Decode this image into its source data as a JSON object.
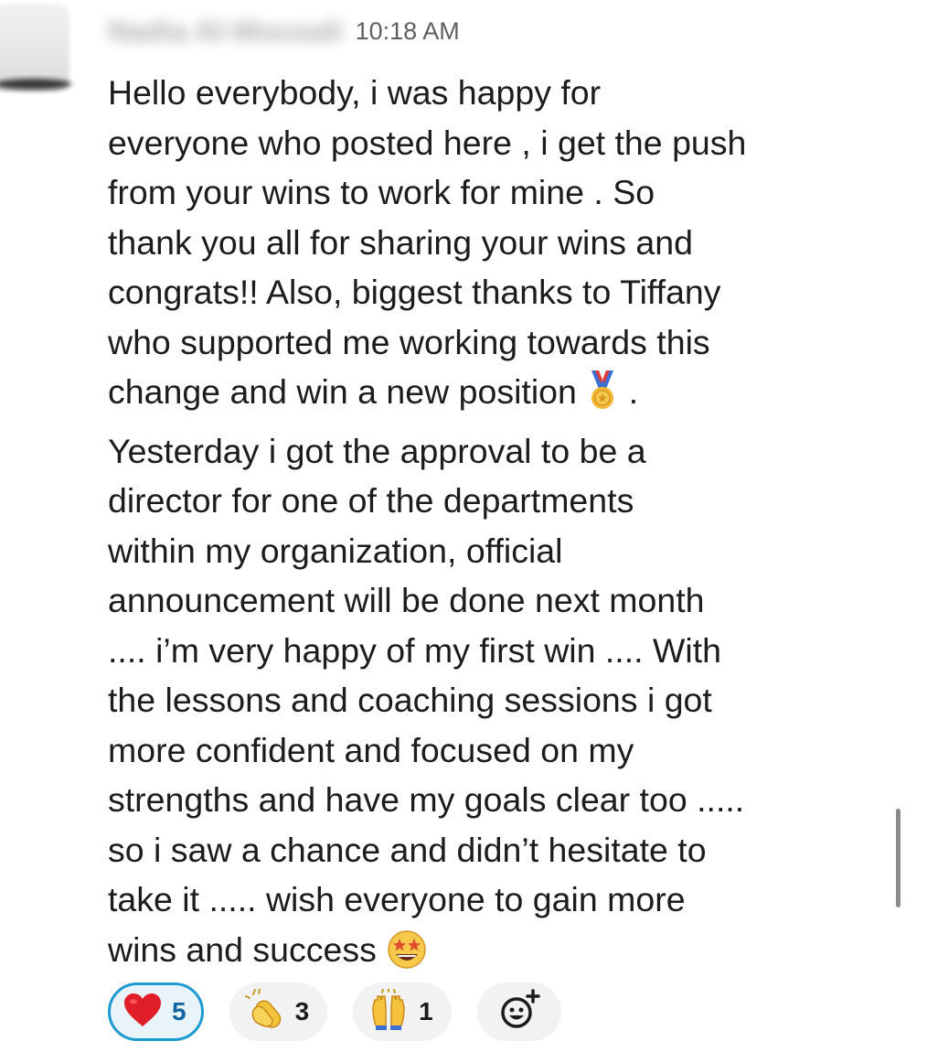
{
  "message": {
    "sender_name": "Nadia Al-Mousali",
    "timestamp": "10:18 AM",
    "lines": [
      "Hello everybody, i was happy for",
      "everyone who posted here , i get the push",
      "from your wins to work for mine . So",
      "thank you all for sharing your wins and",
      "congrats!! Also, biggest thanks to Tiffany",
      "who supported me working towards this",
      "change and win a new position ",
      "Yesterday i got the approval to be a",
      "director for one of the departments",
      "within my organization, official",
      "announcement will be done next month",
      ".... i’m very happy of my first win .... With",
      "the lessons and coaching sessions i got",
      "more confident and focused on my",
      "strengths and have my goals clear too .....",
      "so i saw a chance and didn’t hesitate to",
      "take it ..... wish everyone to gain more",
      "wins and success "
    ],
    "line7_suffix": " .",
    "inline_emojis": [
      "medal-icon",
      "star-struck-icon"
    ]
  },
  "reactions": [
    {
      "icon": "heart-icon",
      "count": "5",
      "active": true,
      "color": "#e01e28"
    },
    {
      "icon": "clapping-hands-icon",
      "count": "3",
      "active": false,
      "color": "#f5c33b"
    },
    {
      "icon": "raising-hands-icon",
      "count": "1",
      "active": false,
      "color": "#f5c33b"
    }
  ],
  "add_reaction": {
    "icon": "add-reaction-icon"
  },
  "colors": {
    "accent": "#1d9bd1",
    "active_bg": "#e8f3fa",
    "text": "#1d1c1d",
    "muted": "#616061"
  }
}
